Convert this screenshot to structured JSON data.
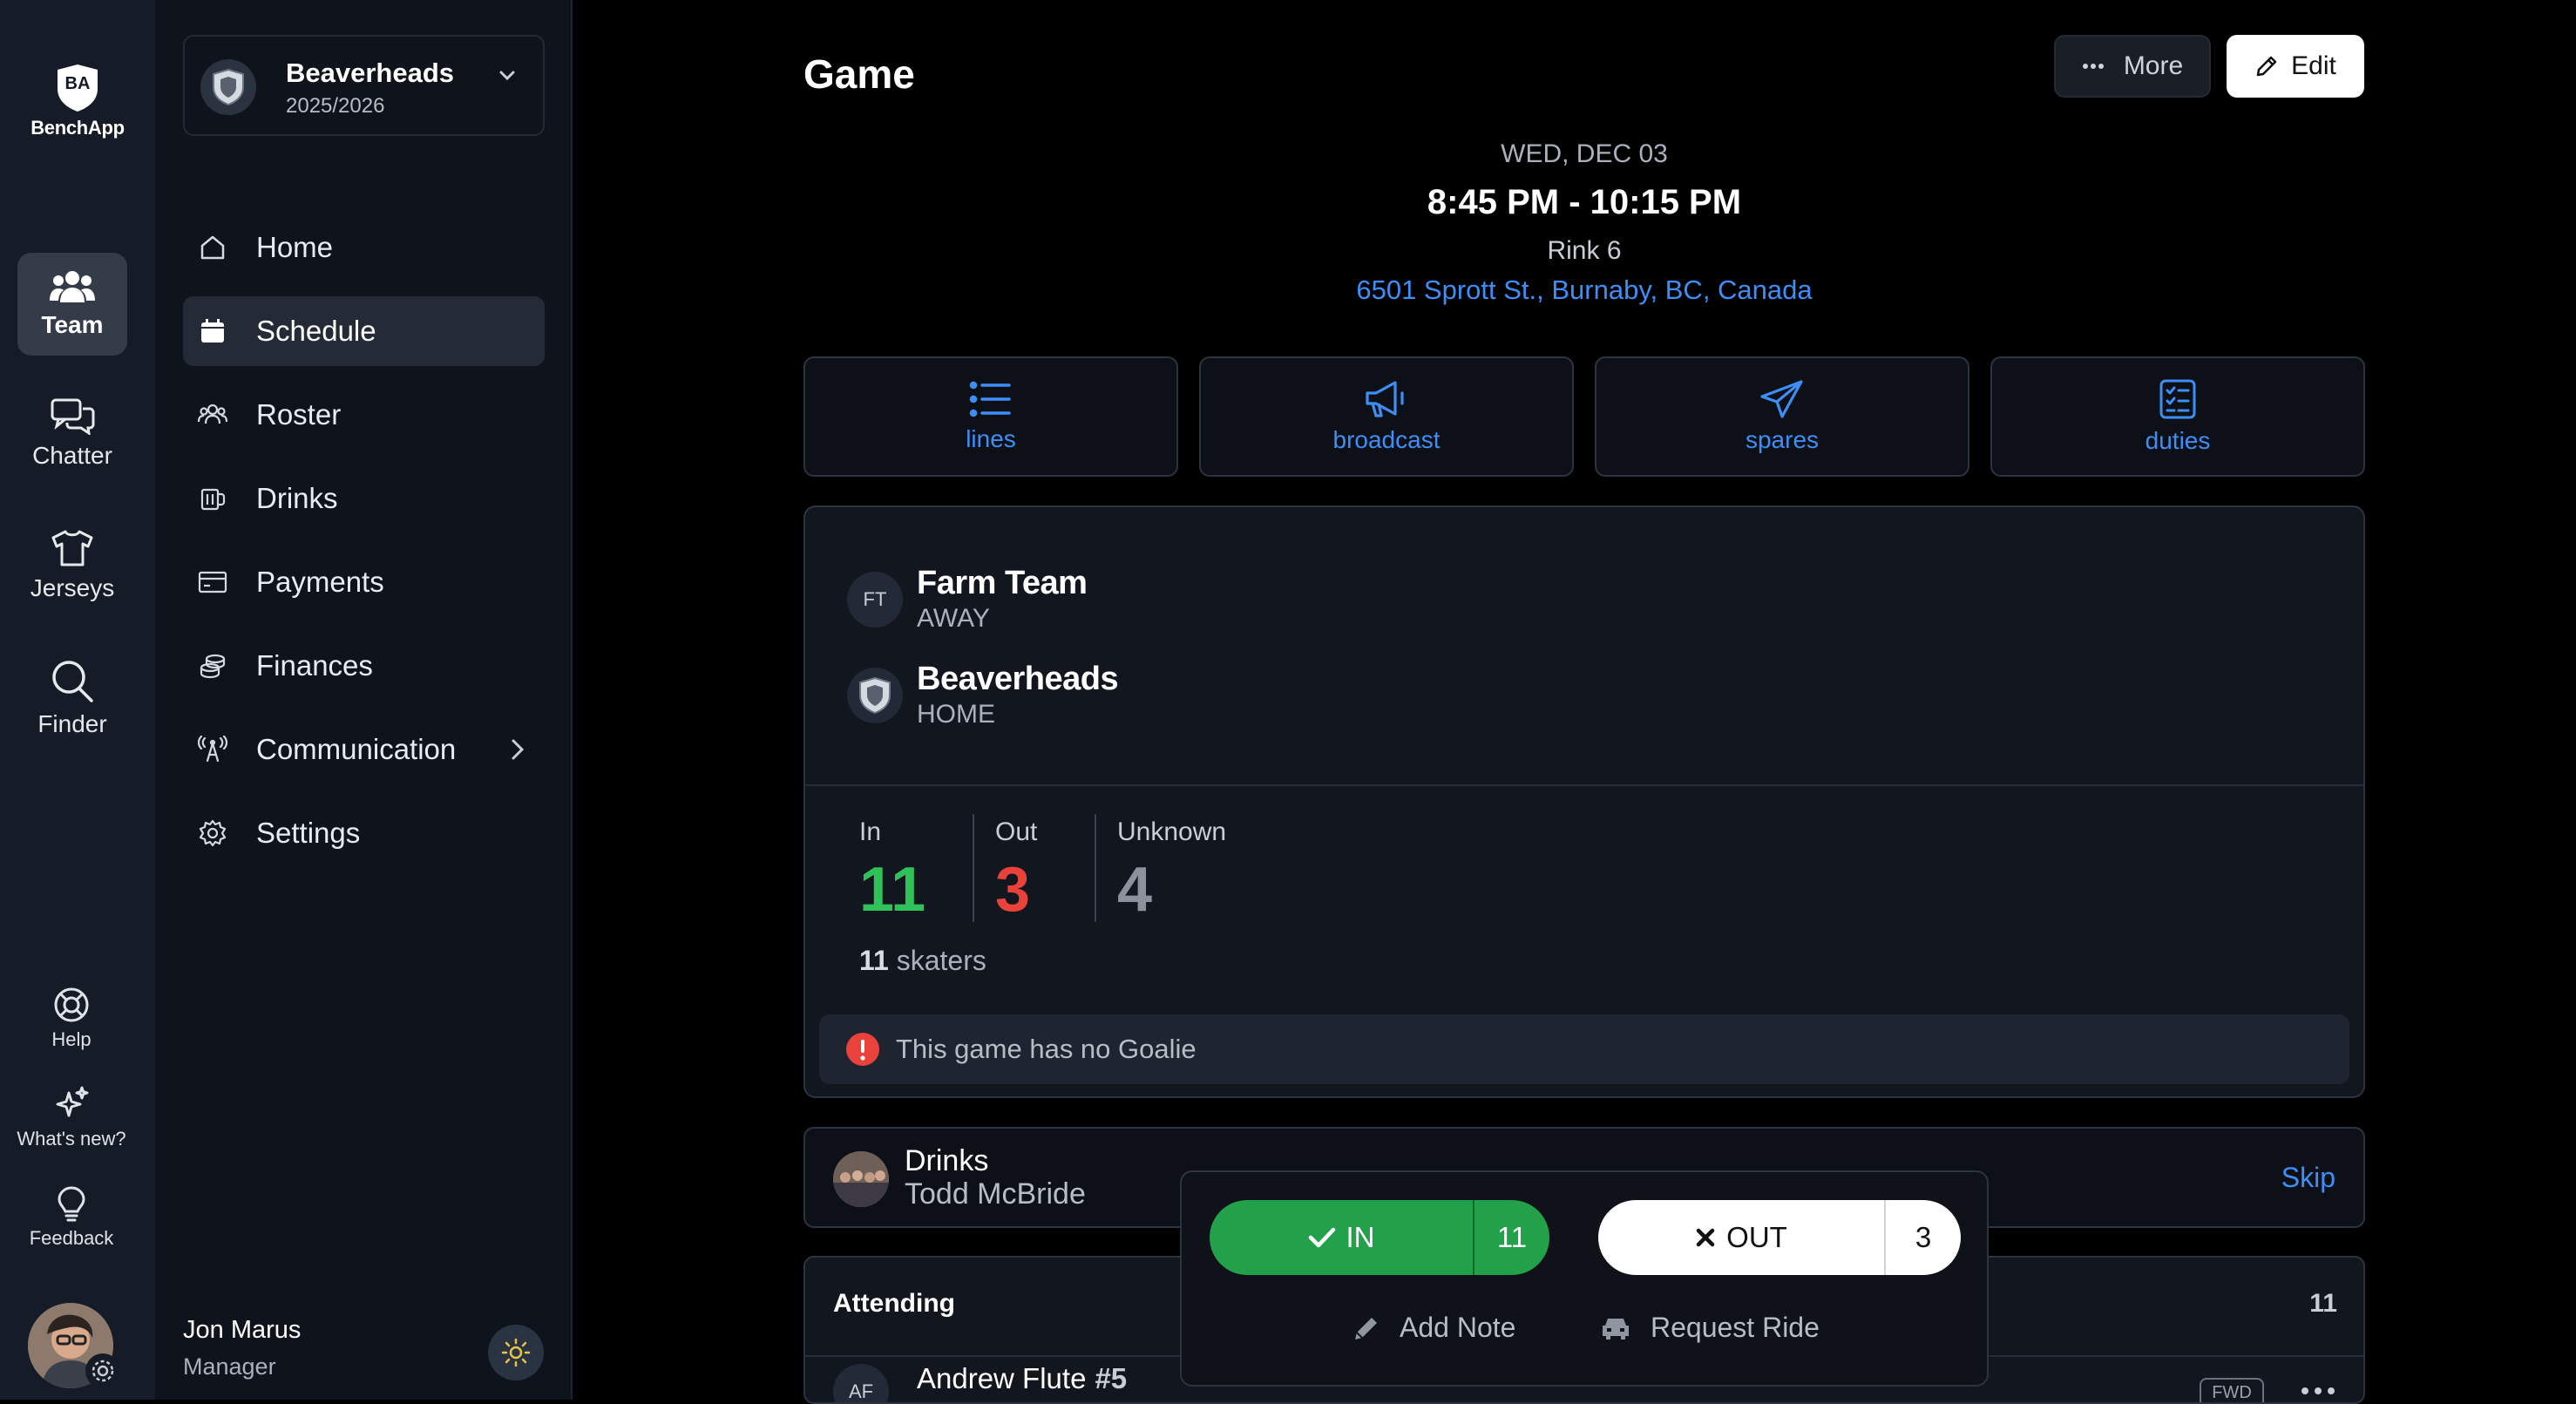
{
  "app": {
    "brand": "BenchApp"
  },
  "rail": {
    "items": [
      {
        "label": "Team",
        "icon": "team-icon"
      },
      {
        "label": "Chatter",
        "icon": "chat-icon"
      },
      {
        "label": "Jerseys",
        "icon": "jersey-icon"
      },
      {
        "label": "Finder",
        "icon": "search-icon"
      }
    ],
    "bottom": [
      {
        "label": "Help",
        "icon": "lifebuoy-icon"
      },
      {
        "label": "What's new?",
        "icon": "sparkle-icon"
      },
      {
        "label": "Feedback",
        "icon": "lightbulb-icon"
      }
    ]
  },
  "sidebar": {
    "team_name": "Beaverheads",
    "season": "2025/2026",
    "nav": [
      {
        "label": "Home",
        "icon": "home-icon"
      },
      {
        "label": "Schedule",
        "icon": "calendar-icon"
      },
      {
        "label": "Roster",
        "icon": "roster-icon"
      },
      {
        "label": "Drinks",
        "icon": "drinks-icon"
      },
      {
        "label": "Payments",
        "icon": "payments-icon"
      },
      {
        "label": "Finances",
        "icon": "coins-icon"
      },
      {
        "label": "Communication",
        "icon": "broadcast-tower-icon"
      },
      {
        "label": "Settings",
        "icon": "gear-icon"
      }
    ],
    "user": {
      "name": "Jon Marus",
      "role": "Manager"
    }
  },
  "header": {
    "title": "Game",
    "more_label": "More",
    "edit_label": "Edit"
  },
  "event": {
    "date": "WED, DEC 03",
    "time": "8:45 PM - 10:15 PM",
    "rink": "Rink 6",
    "address": "6501 Sprott St., Burnaby, BC, Canada"
  },
  "actions": [
    {
      "label": "lines",
      "icon": "list-icon"
    },
    {
      "label": "broadcast",
      "icon": "megaphone-icon"
    },
    {
      "label": "spares",
      "icon": "paper-plane-icon"
    },
    {
      "label": "duties",
      "icon": "checklist-icon"
    }
  ],
  "matchup": {
    "away": {
      "initials": "FT",
      "name": "Farm Team",
      "side": "AWAY"
    },
    "home": {
      "name": "Beaverheads",
      "side": "HOME"
    }
  },
  "attendance": {
    "in_label": "In",
    "in": "11",
    "out_label": "Out",
    "out": "3",
    "unknown_label": "Unknown",
    "unknown": "4",
    "skaters_count": "11",
    "skaters_label": "skaters",
    "warning": "This game has no Goalie",
    "colors": {
      "in": "#2fc15a",
      "out": "#e8423a",
      "unknown": "#8c929c"
    }
  },
  "duty": {
    "title": "Drinks",
    "person": "Todd McBride",
    "skip_label": "Skip"
  },
  "attending": {
    "label": "Attending",
    "count": "11",
    "first": {
      "initials": "AF",
      "name": "Andrew Flute",
      "number": "#5",
      "position": "FWD"
    }
  },
  "rsvp": {
    "in_label": "IN",
    "in_count": "11",
    "out_label": "OUT",
    "out_count": "3",
    "note_label": "Add Note",
    "ride_label": "Request Ride"
  }
}
